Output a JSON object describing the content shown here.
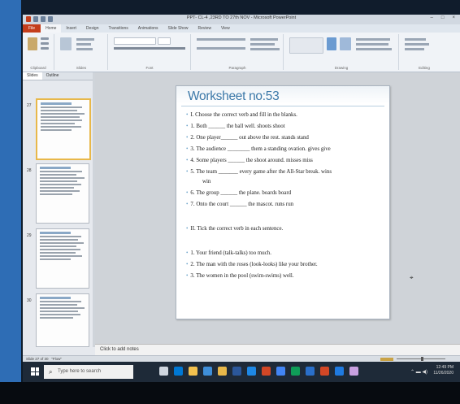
{
  "window": {
    "title": "PPT- CL-4 ,23RD TO 27th NOV - Microsoft PowerPoint",
    "controls": [
      "–",
      "□",
      "×"
    ]
  },
  "ribbon": {
    "tabs": [
      "File",
      "Home",
      "Insert",
      "Design",
      "Transitions",
      "Animations",
      "Slide Show",
      "Review",
      "View"
    ],
    "active_tab": "Home",
    "groups": [
      "Clipboard",
      "Slides",
      "Font",
      "Paragraph",
      "Drawing",
      "Editing"
    ]
  },
  "left_pane": {
    "tabs": [
      "Slides",
      "Outline"
    ],
    "slide_numbers": [
      "27",
      "28",
      "29",
      "30"
    ]
  },
  "slide": {
    "title": "Worksheet no:53",
    "lines": [
      "I. Choose the correct verb and fill in the blanks.",
      "1. Both ______ the ball well.      shoots  shoot",
      "2. One player______ out above the rest.   stands  stand",
      "3. The audience ________ them a standing ovation. gives    give",
      "4. Some players ______ the shoot around.            misses  miss",
      "5. The team _______ every game after the All-Star break.  wins",
      "6. The group ______ the plane.    boards  board",
      "7.  Onto the court ______ the mascot.      runs     run",
      "II. Tick the correct verb in each sentence.",
      "1. Your friend (talk-talks) too much.",
      "2. The man with the roses (look-looks) like your brother.",
      "3. The women in the pool (swim-swims) well."
    ],
    "continuation": "win"
  },
  "notes": {
    "placeholder": "Click to add notes"
  },
  "status": {
    "slide_info": "Slide 27 of 30",
    "theme": "\"Flow\""
  },
  "taskbar": {
    "search_placeholder": "Type here to search",
    "time": "12:49 PM",
    "date": "11/26/2020"
  }
}
